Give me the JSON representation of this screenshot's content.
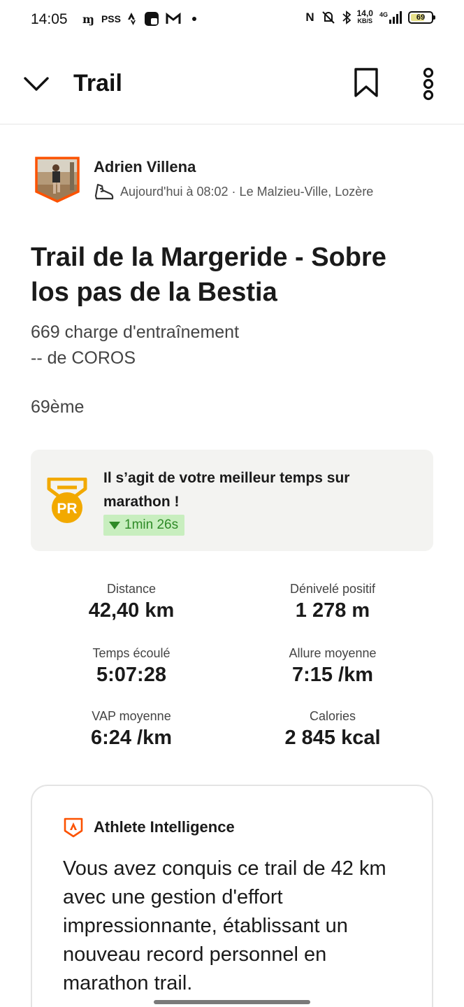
{
  "status_bar": {
    "time": "14:05",
    "left_icons": [
      "mm-icon",
      "pss-icon",
      "strava-icon",
      "app-icon",
      "gmail-icon",
      "dot-icon"
    ],
    "pss_label": "PSS",
    "speed_value": "14,0",
    "speed_unit": "KB/S",
    "network": "4G",
    "battery": "69",
    "battery_level": 0.69
  },
  "header": {
    "title": "Trail"
  },
  "athlete": {
    "name": "Adrien Villena",
    "meta": "Aujourd'hui à 08:02 · Le Malzieu-Ville, Lozère"
  },
  "activity": {
    "title": "Trail de la Margeride - Sobre los pas de la Bestia",
    "training_load": "669 charge d'entraînement",
    "source": "-- de COROS",
    "rank": "69ème"
  },
  "pr": {
    "message": "Il s’agit de votre meilleur temps sur marathon !",
    "improvement": "1min 26s",
    "icon_label": "PR"
  },
  "stats": [
    {
      "label": "Distance",
      "value": "42,40 km"
    },
    {
      "label": "Dénivelé positif",
      "value": "1 278 m"
    },
    {
      "label": "Temps écoulé",
      "value": "5:07:28"
    },
    {
      "label": "Allure moyenne",
      "value": "7:15 /km"
    },
    {
      "label": "VAP moyenne",
      "value": "6:24 /km"
    },
    {
      "label": "Calories",
      "value": "2 845 kcal"
    }
  ],
  "athlete_intelligence": {
    "title": "Athlete Intelligence",
    "text": "Vous avez conquis ce trail de 42 km avec une gestion d'effort impressionnante, établissant un nouveau record personnel en marathon trail."
  },
  "colors": {
    "accent": "#fc5200",
    "pr_gold": "#f2a900",
    "pr_green_bg": "#c8eebf",
    "pr_green_text": "#2e8a27",
    "card_bg": "#f3f3f1"
  }
}
